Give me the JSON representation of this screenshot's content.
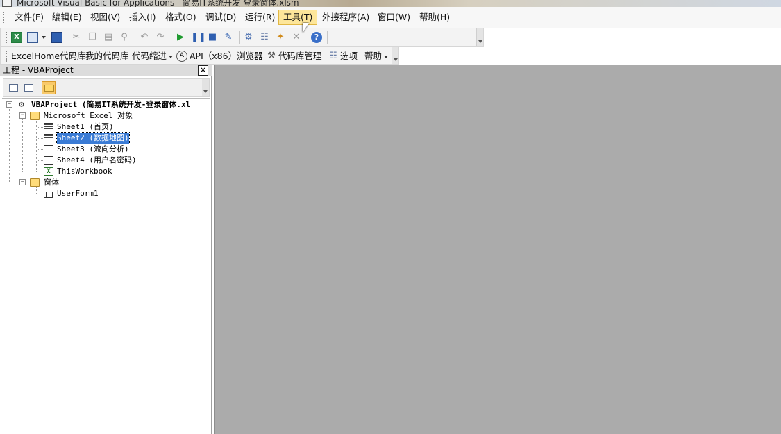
{
  "window": {
    "title": "Microsoft Visual Basic for Applications - 简易IT系统开发-登录窗体.xlsm"
  },
  "menubar": {
    "items": [
      {
        "label": "文件(F)"
      },
      {
        "label": "编辑(E)"
      },
      {
        "label": "视图(V)"
      },
      {
        "label": "插入(I)"
      },
      {
        "label": "格式(O)"
      },
      {
        "label": "调试(D)"
      },
      {
        "label": "运行(R)"
      },
      {
        "label": "工具(T)",
        "active": true
      },
      {
        "label": "外接程序(A)"
      },
      {
        "label": "窗口(W)"
      },
      {
        "label": "帮助(H)"
      }
    ]
  },
  "toolbar1": {
    "icons": [
      "excel-icon",
      "insert-userform-icon",
      "save-icon",
      "cut-icon",
      "copy-icon",
      "paste-icon",
      "find-icon",
      "undo-icon",
      "redo-icon",
      "run-icon",
      "break-icon",
      "reset-icon",
      "design-mode-icon",
      "project-explorer-icon",
      "properties-icon",
      "object-browser-icon",
      "toolbox-icon",
      "help-icon"
    ]
  },
  "toolbar2": {
    "excelhome": "ExcelHome代码库",
    "mycode": "我的代码库",
    "indent": "代码缩进",
    "api": "API（x86）浏览器",
    "manage": "代码库管理",
    "options": "选项",
    "help": "帮助"
  },
  "explorer": {
    "title": "工程 - VBAProject",
    "tree": {
      "project": "VBAProject (简易IT系统开发-登录窗体.xl",
      "excel_objects": "Microsoft Excel 对象",
      "sheet1": "Sheet1 (首页)",
      "sheet2": "Sheet2 (数据地图)",
      "sheet3": "Sheet3 (流向分析)",
      "sheet4": "Sheet4 (用户名密码)",
      "workbook": "ThisWorkbook",
      "forms": "窗体",
      "userform1": "UserForm1"
    }
  },
  "colors": {
    "workspace_bg": "#ababab",
    "selection": "#3a7bd5",
    "active_menu": "#fde69a"
  }
}
